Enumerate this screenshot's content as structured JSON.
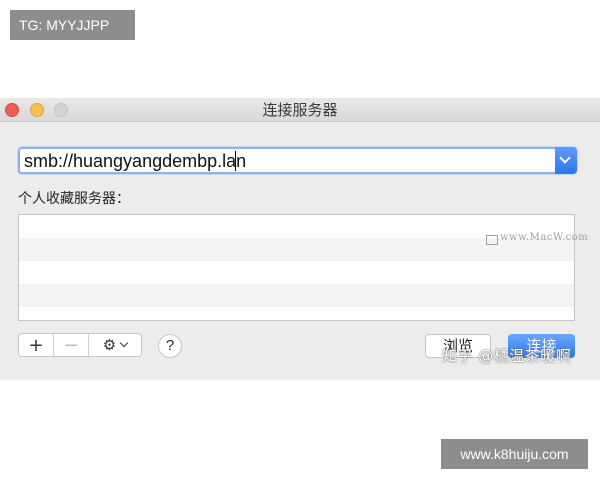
{
  "overlay": {
    "tag": "TG: MYYJJPP",
    "site": "www.k8huiju.com"
  },
  "window": {
    "title": "连接服务器",
    "traffic_lights": [
      "close",
      "minimize",
      "zoom"
    ]
  },
  "address": {
    "value": "smb://huangyangdembp.lan",
    "dropdown_icon": "chevron-down-icon",
    "accent": "#2f76e8"
  },
  "favorites": {
    "label": "个人收藏服务器：",
    "rows": [
      "",
      "",
      "",
      ""
    ]
  },
  "toolbar": {
    "add_label": "+",
    "remove_label": "−",
    "gear_icon": "⚙",
    "help_label": "?",
    "browse_label": "浏览",
    "connect_label": "连接"
  },
  "watermarks": {
    "macw": "www.MacW.com",
    "zhihu": "知乎 @橘温茶暖啊"
  }
}
